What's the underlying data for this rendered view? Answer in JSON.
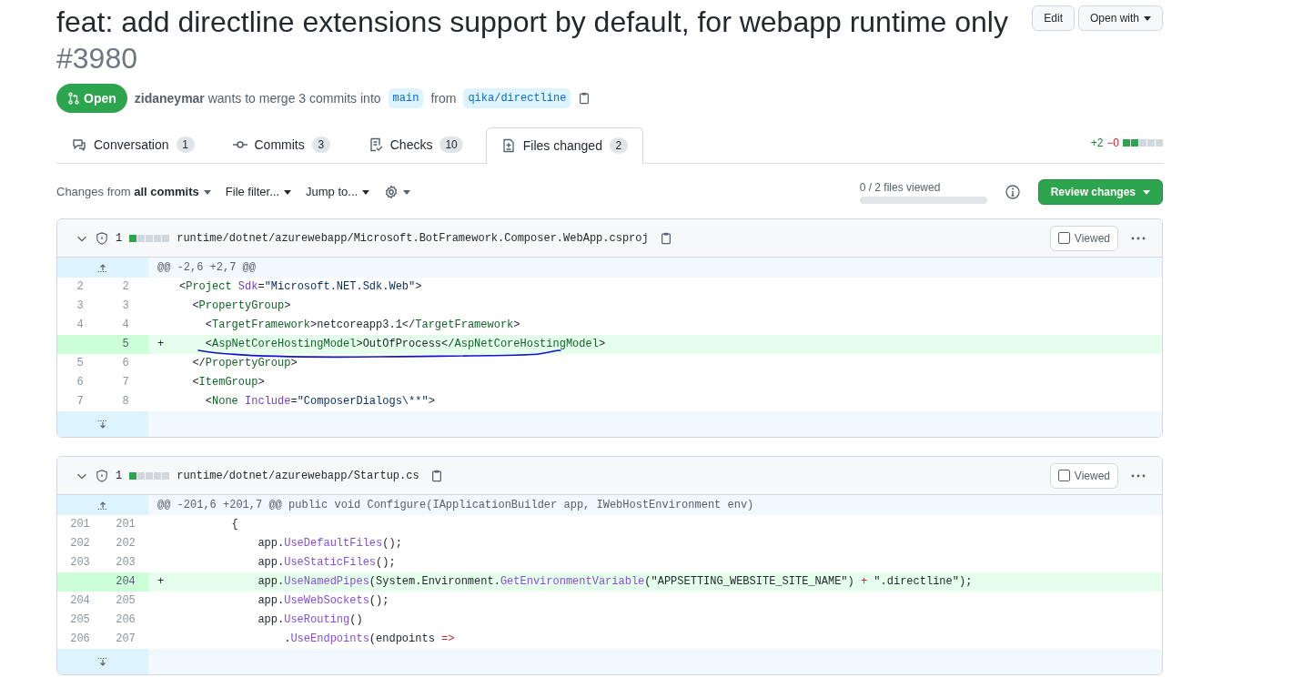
{
  "title": "feat: add directline extensions support by default, for webapp runtime only",
  "number": "#3980",
  "header_buttons": [
    {
      "label": "Edit",
      "dropdown": false
    },
    {
      "label": "Open with",
      "dropdown": true
    }
  ],
  "state_badge": {
    "label": "Open"
  },
  "summary": {
    "author": "zidaneymar",
    "text": "wants to merge 3 commits into",
    "base": "main",
    "from": "from",
    "head": "qika/directline"
  },
  "tabs": [
    {
      "label": "Conversation",
      "count": "1",
      "selected": false
    },
    {
      "label": "Commits",
      "count": "3",
      "selected": false
    },
    {
      "label": "Checks",
      "count": "10",
      "selected": false
    },
    {
      "label": "Files changed",
      "count": "2",
      "selected": true
    }
  ],
  "diffstat": {
    "added": "+2",
    "removed": "−0",
    "blocks": [
      {
        "added": true
      },
      {
        "added": true
      },
      {
        "added": false
      },
      {
        "added": false
      },
      {
        "added": false
      }
    ]
  },
  "toolbar": {
    "changes_prefix": "Changes from",
    "changes_value": "all commits",
    "file_filter": "File filter...",
    "jump_to": "Jump to...",
    "files_viewed": "0 / 2 files viewed",
    "progress": {
      "level": 0
    },
    "review_button": "Review changes"
  },
  "files": [
    {
      "changes": "1",
      "blocks": [
        {
          "added": true
        },
        {
          "added": false
        },
        {
          "added": false
        },
        {
          "added": false
        },
        {
          "added": false
        }
      ],
      "path": "runtime/dotnet/azurewebapp/Microsoft.BotFramework.Composer.WebApp.csproj",
      "viewed_label": "Viewed",
      "viewed": false,
      "hunk": "@@ -2,6 +2,7 @@",
      "lines": [
        {
          "old": "2",
          "new": "2",
          "added": false,
          "underlined": false,
          "segments": [
            {
              "kind": "plain",
              "text": "<"
            },
            {
              "kind": "tag",
              "text": "Project"
            },
            {
              "kind": "attr",
              "text": " Sdk"
            },
            {
              "kind": "plain",
              "text": "="
            },
            {
              "kind": "string",
              "text": "\"Microsoft.NET.Sdk.Web\""
            },
            {
              "kind": "plain",
              "text": ">"
            }
          ]
        },
        {
          "old": "3",
          "new": "3",
          "added": false,
          "underlined": false,
          "segments": [
            {
              "kind": "plain",
              "text": "  <"
            },
            {
              "kind": "tag",
              "text": "PropertyGroup"
            },
            {
              "kind": "plain",
              "text": ">"
            }
          ]
        },
        {
          "old": "4",
          "new": "4",
          "added": false,
          "underlined": false,
          "segments": [
            {
              "kind": "plain",
              "text": "    <"
            },
            {
              "kind": "tag",
              "text": "TargetFramework"
            },
            {
              "kind": "plain",
              "text": ">netcoreapp3.1</"
            },
            {
              "kind": "tag",
              "text": "TargetFramework"
            },
            {
              "kind": "plain",
              "text": ">"
            }
          ]
        },
        {
          "new": "5",
          "added": true,
          "marker": "+",
          "underlined": true,
          "segments": [
            {
              "kind": "plain",
              "text": "    <"
            },
            {
              "kind": "tag",
              "text": "AspNetCoreHostingModel"
            },
            {
              "kind": "plain",
              "text": ">OutOfProcess</"
            },
            {
              "kind": "tag",
              "text": "AspNetCoreHostingModel"
            },
            {
              "kind": "plain",
              "text": ">"
            }
          ]
        },
        {
          "old": "5",
          "new": "6",
          "added": false,
          "underlined": false,
          "segments": [
            {
              "kind": "plain",
              "text": "  </"
            },
            {
              "kind": "tag",
              "text": "PropertyGroup"
            },
            {
              "kind": "plain",
              "text": ">"
            }
          ]
        },
        {
          "old": "6",
          "new": "7",
          "added": false,
          "underlined": false,
          "segments": [
            {
              "kind": "plain",
              "text": "  <"
            },
            {
              "kind": "tag",
              "text": "ItemGroup"
            },
            {
              "kind": "plain",
              "text": ">"
            }
          ]
        },
        {
          "old": "7",
          "new": "8",
          "added": false,
          "underlined": false,
          "segments": [
            {
              "kind": "plain",
              "text": "    <"
            },
            {
              "kind": "tag",
              "text": "None"
            },
            {
              "kind": "attr",
              "text": " Include"
            },
            {
              "kind": "plain",
              "text": "="
            },
            {
              "kind": "string",
              "text": "\"ComposerDialogs\\**\""
            },
            {
              "kind": "plain",
              "text": ">"
            }
          ]
        }
      ]
    },
    {
      "changes": "1",
      "blocks": [
        {
          "added": true
        },
        {
          "added": false
        },
        {
          "added": false
        },
        {
          "added": false
        },
        {
          "added": false
        }
      ],
      "path": "runtime/dotnet/azurewebapp/Startup.cs",
      "viewed_label": "Viewed",
      "viewed": false,
      "hunk": "@@ -201,6 +201,7 @@ public void Configure(IApplicationBuilder app, IWebHostEnvironment env)",
      "lines": [
        {
          "old": "201",
          "new": "201",
          "added": false,
          "underlined": false,
          "segments": [
            {
              "kind": "plain",
              "text": "        {"
            }
          ]
        },
        {
          "old": "202",
          "new": "202",
          "added": false,
          "underlined": false,
          "segments": [
            {
              "kind": "plain",
              "text": "            app."
            },
            {
              "kind": "fn",
              "text": "UseDefaultFiles"
            },
            {
              "kind": "plain",
              "text": "();"
            }
          ]
        },
        {
          "old": "203",
          "new": "203",
          "added": false,
          "underlined": false,
          "segments": [
            {
              "kind": "plain",
              "text": "            app."
            },
            {
              "kind": "fn",
              "text": "UseStaticFiles"
            },
            {
              "kind": "plain",
              "text": "();"
            }
          ]
        },
        {
          "new": "204",
          "added": true,
          "marker": "+",
          "underlined": false,
          "segments": [
            {
              "kind": "plain",
              "text": "            app."
            },
            {
              "kind": "fn",
              "text": "UseNamedPipes"
            },
            {
              "kind": "plain",
              "text": "(System.Environment."
            },
            {
              "kind": "fn",
              "text": "GetEnvironmentVariable"
            },
            {
              "kind": "plain",
              "text": "(\"APPSETTING_WEBSITE_SITE_NAME\") "
            },
            {
              "kind": "op",
              "text": "+"
            },
            {
              "kind": "plain",
              "text": " \".directline\");"
            }
          ]
        },
        {
          "old": "204",
          "new": "205",
          "added": false,
          "underlined": false,
          "segments": [
            {
              "kind": "plain",
              "text": "            app."
            },
            {
              "kind": "fn",
              "text": "UseWebSockets"
            },
            {
              "kind": "plain",
              "text": "();"
            }
          ]
        },
        {
          "old": "205",
          "new": "206",
          "added": false,
          "underlined": false,
          "segments": [
            {
              "kind": "plain",
              "text": "            app."
            },
            {
              "kind": "fn",
              "text": "UseRouting"
            },
            {
              "kind": "plain",
              "text": "()"
            }
          ]
        },
        {
          "old": "206",
          "new": "207",
          "added": false,
          "underlined": false,
          "segments": [
            {
              "kind": "plain",
              "text": "                ."
            },
            {
              "kind": "fn",
              "text": "UseEndpoints"
            },
            {
              "kind": "plain",
              "text": "(endpoints "
            },
            {
              "kind": "op",
              "text": "=>"
            }
          ]
        }
      ]
    }
  ]
}
